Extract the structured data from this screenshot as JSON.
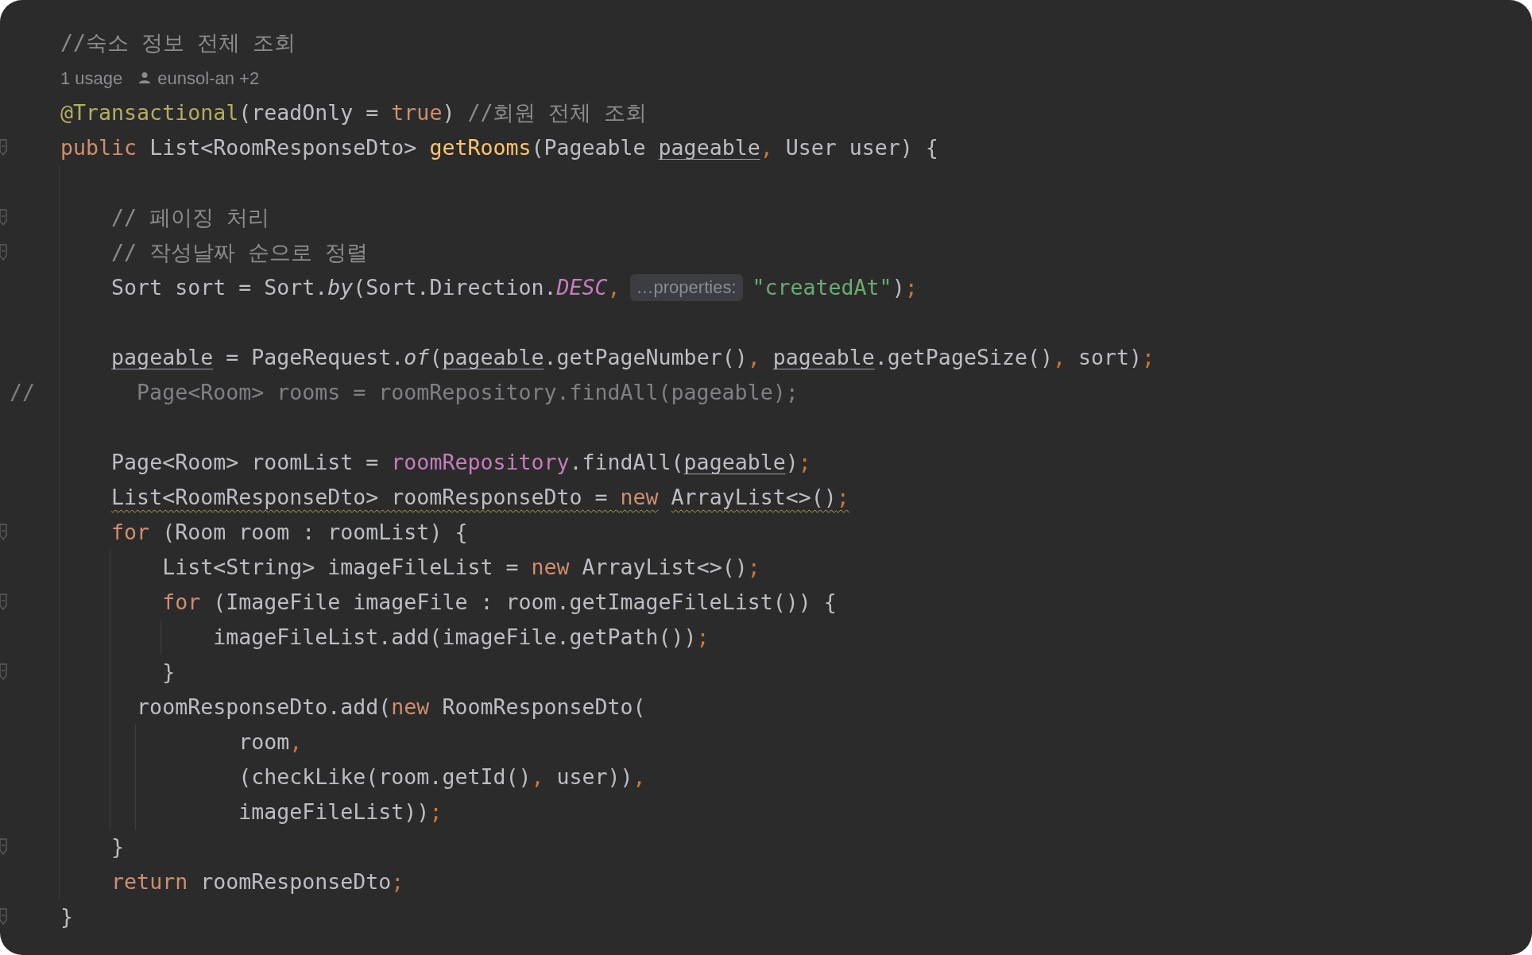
{
  "editor": {
    "lines": [
      {
        "kind": "code",
        "fold": false,
        "segments": [
          {
            "kind": "code",
            "tokens": [
              {
                "text": "    //숙소 정보 전체 조회",
                "kind": "comment"
              }
            ]
          }
        ]
      },
      {
        "kind": "meta",
        "fold": false,
        "usage": "1 usage",
        "author": "eunsol-an +2"
      },
      {
        "kind": "code",
        "fold": false,
        "segments": [
          {
            "kind": "code",
            "tokens": [
              {
                "text": "    @Transactional",
                "kind": "ann"
              },
              {
                "text": "(readOnly = ",
                "kind": "plain"
              },
              {
                "text": "true",
                "kind": "kw"
              },
              {
                "text": ") ",
                "kind": "plain"
              },
              {
                "text": "//회원 전체 조회",
                "kind": "comment"
              }
            ]
          }
        ]
      },
      {
        "kind": "code",
        "fold": true,
        "segments": [
          {
            "kind": "code",
            "tokens": [
              {
                "text": "    public",
                "kind": "kw"
              },
              {
                "text": " List<RoomResponseDto> ",
                "kind": "plain"
              },
              {
                "text": "getRooms",
                "kind": "fn"
              },
              {
                "text": "(Pageable ",
                "kind": "plain"
              },
              {
                "text": "pageable",
                "kind": "param"
              },
              {
                "text": ",",
                "kind": "punct"
              },
              {
                "text": " User user) {",
                "kind": "plain"
              }
            ]
          }
        ]
      },
      {
        "kind": "blank",
        "fold": false
      },
      {
        "kind": "code",
        "fold": true,
        "segments": [
          {
            "kind": "code",
            "tokens": [
              {
                "text": "        // 페이징 처리",
                "kind": "comment"
              }
            ]
          }
        ]
      },
      {
        "kind": "code",
        "fold": true,
        "segments": [
          {
            "kind": "code",
            "tokens": [
              {
                "text": "        // 작성날짜 순으로 정렬",
                "kind": "comment"
              }
            ]
          }
        ]
      },
      {
        "kind": "code",
        "fold": false,
        "segments": [
          {
            "kind": "code",
            "tokens": [
              {
                "text": "        Sort sort = Sort.",
                "kind": "plain"
              },
              {
                "text": "by",
                "kind": "italic"
              },
              {
                "text": "(Sort.Direction.",
                "kind": "plain"
              },
              {
                "text": "DESC",
                "kind": "static"
              },
              {
                "text": ",",
                "kind": "punct"
              }
            ]
          },
          {
            "kind": "hint",
            "text": "…properties:"
          },
          {
            "kind": "code",
            "tokens": [
              {
                "text": "\"createdAt\"",
                "kind": "str"
              },
              {
                "text": ")",
                "kind": "plain"
              },
              {
                "text": ";",
                "kind": "punct"
              }
            ]
          }
        ]
      },
      {
        "kind": "blank",
        "fold": false
      },
      {
        "kind": "code",
        "fold": false,
        "segments": [
          {
            "kind": "code",
            "tokens": [
              {
                "text": "        pageable",
                "kind": "param"
              },
              {
                "text": " = PageRequest.",
                "kind": "plain"
              },
              {
                "text": "of",
                "kind": "italic"
              },
              {
                "text": "(",
                "kind": "plain"
              },
              {
                "text": "pageable",
                "kind": "param"
              },
              {
                "text": ".getPageNumber()",
                "kind": "plain"
              },
              {
                "text": ", ",
                "kind": "punct"
              },
              {
                "text": "pageable",
                "kind": "param"
              },
              {
                "text": ".getPageSize()",
                "kind": "plain"
              },
              {
                "text": ",",
                "kind": "punct"
              },
              {
                "text": " sort)",
                "kind": "plain"
              },
              {
                "text": ";",
                "kind": "punct"
              }
            ]
          }
        ]
      },
      {
        "kind": "code",
        "fold": false,
        "segments": [
          {
            "kind": "code",
            "tokens": [
              {
                "text": "//        Page<Room> rooms = roomRepository.findAll(pageable);",
                "kind": "dim"
              }
            ]
          }
        ]
      },
      {
        "kind": "blank",
        "fold": false
      },
      {
        "kind": "code",
        "fold": false,
        "segments": [
          {
            "kind": "code",
            "tokens": [
              {
                "text": "        Page<Room> roomList = ",
                "kind": "plain"
              },
              {
                "text": "roomRepository",
                "kind": "field"
              },
              {
                "text": ".findAll(",
                "kind": "plain"
              },
              {
                "text": "pageable",
                "kind": "param"
              },
              {
                "text": ")",
                "kind": "plain"
              },
              {
                "text": ";",
                "kind": "punct"
              }
            ]
          }
        ]
      },
      {
        "kind": "code",
        "fold": false,
        "segments": [
          {
            "kind": "warning",
            "tokens": [
              {
                "text": "        List<RoomResponseDto> roomResponseDto = ",
                "kind": "plain"
              },
              {
                "text": "new",
                "kind": "kw"
              },
              {
                "text": " ArrayList<>()",
                "kind": "plain"
              },
              {
                "text": ";",
                "kind": "punct"
              }
            ]
          }
        ]
      },
      {
        "kind": "code",
        "fold": true,
        "segments": [
          {
            "kind": "code",
            "tokens": [
              {
                "text": "        for",
                "kind": "kw"
              },
              {
                "text": " (Room room : roomList) {",
                "kind": "plain"
              }
            ]
          }
        ]
      },
      {
        "kind": "code",
        "fold": false,
        "segments": [
          {
            "kind": "code",
            "tokens": [
              {
                "text": "            List<String> imageFileList = ",
                "kind": "plain"
              },
              {
                "text": "new",
                "kind": "kw"
              },
              {
                "text": " ArrayList<>()",
                "kind": "plain"
              },
              {
                "text": ";",
                "kind": "punct"
              }
            ]
          }
        ]
      },
      {
        "kind": "code",
        "fold": true,
        "segments": [
          {
            "kind": "code",
            "tokens": [
              {
                "text": "            for",
                "kind": "kw"
              },
              {
                "text": " (ImageFile imageFile : room.getImageFileList()) {",
                "kind": "plain"
              }
            ]
          }
        ]
      },
      {
        "kind": "code",
        "fold": false,
        "segments": [
          {
            "kind": "code",
            "tokens": [
              {
                "text": "                imageFileList.add(imageFile.getPath())",
                "kind": "plain"
              },
              {
                "text": ";",
                "kind": "punct"
              }
            ]
          }
        ]
      },
      {
        "kind": "code",
        "fold": true,
        "segments": [
          {
            "kind": "code",
            "tokens": [
              {
                "text": "            }",
                "kind": "plain"
              }
            ]
          }
        ]
      },
      {
        "kind": "code",
        "fold": false,
        "segments": [
          {
            "kind": "code",
            "tokens": [
              {
                "text": "          roomResponseDto.add(",
                "kind": "plain"
              },
              {
                "text": "new",
                "kind": "kw"
              },
              {
                "text": " RoomResponseDto(",
                "kind": "plain"
              }
            ]
          }
        ]
      },
      {
        "kind": "code",
        "fold": false,
        "segments": [
          {
            "kind": "code",
            "tokens": [
              {
                "text": "                  room",
                "kind": "plain"
              },
              {
                "text": ",",
                "kind": "punct"
              }
            ]
          }
        ]
      },
      {
        "kind": "code",
        "fold": false,
        "segments": [
          {
            "kind": "code",
            "tokens": [
              {
                "text": "                  (checkLike(room.getId()",
                "kind": "plain"
              },
              {
                "text": ",",
                "kind": "punct"
              },
              {
                "text": " user))",
                "kind": "plain"
              },
              {
                "text": ",",
                "kind": "punct"
              }
            ]
          }
        ]
      },
      {
        "kind": "code",
        "fold": false,
        "segments": [
          {
            "kind": "code",
            "tokens": [
              {
                "text": "                  imageFileList))",
                "kind": "plain"
              },
              {
                "text": ";",
                "kind": "punct"
              }
            ]
          }
        ]
      },
      {
        "kind": "code",
        "fold": true,
        "segments": [
          {
            "kind": "code",
            "tokens": [
              {
                "text": "        }",
                "kind": "plain"
              }
            ]
          }
        ]
      },
      {
        "kind": "code",
        "fold": false,
        "segments": [
          {
            "kind": "code",
            "tokens": [
              {
                "text": "        return",
                "kind": "kw"
              },
              {
                "text": " roomResponseDto",
                "kind": "plain"
              },
              {
                "text": ";",
                "kind": "punct"
              }
            ]
          }
        ]
      },
      {
        "kind": "code",
        "fold": true,
        "segments": [
          {
            "kind": "code",
            "tokens": [
              {
                "text": "    }",
                "kind": "plain"
              }
            ]
          }
        ]
      }
    ]
  }
}
